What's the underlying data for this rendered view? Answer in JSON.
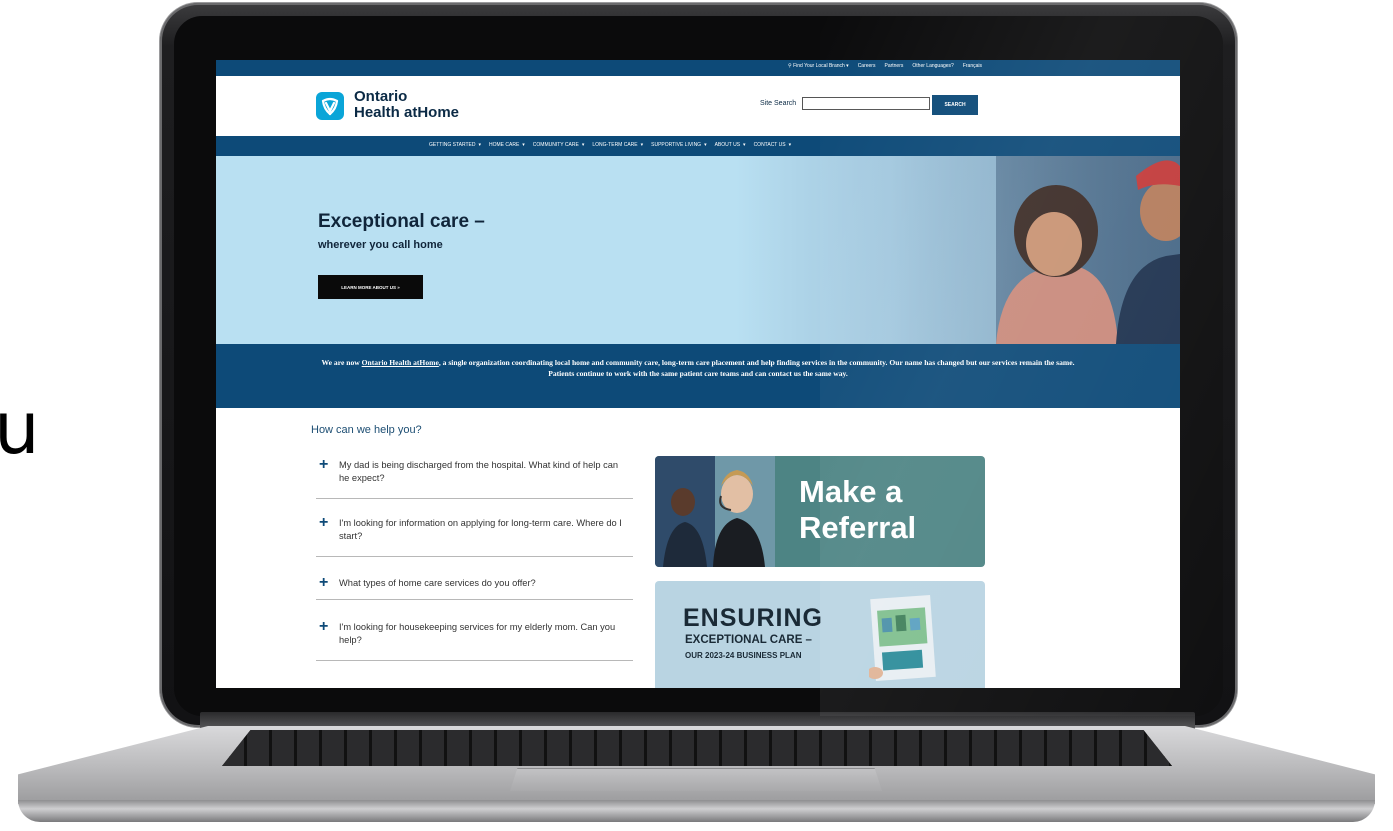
{
  "edge_glyph": "u",
  "screen": {
    "utility_bar": {
      "links": [
        "Find Your Local Branch",
        "Careers",
        "Partners",
        "Other Languages?",
        "Français"
      ]
    },
    "logo": {
      "line1": "Ontario",
      "line2": "Health atHome"
    },
    "search": {
      "label": "Site Search",
      "input_value": "",
      "button": "SEARCH"
    },
    "main_nav": {
      "items": [
        "GETTING STARTED",
        "HOME CARE",
        "COMMUNITY CARE",
        "LONG-TERM CARE",
        "SUPPORTIVE LIVING",
        "ABOUT US",
        "CONTACT US"
      ]
    },
    "hero": {
      "title": "Exceptional care –",
      "subtitle": "wherever you call home",
      "button": "LEARN MORE ABOUT US »"
    },
    "notice": {
      "before": "We are now ",
      "link": "Ontario Health atHome",
      "after": ", a single organization coordinating local home and community care, long-term care placement and help finding services in the community. Our name has changed but our services remain the same. Patients continue to work with the same patient care teams and can contact us the same way."
    },
    "help": {
      "title": "How can we help you?",
      "questions": [
        "My dad is being discharged from the hospital. What kind of help can he expect?",
        "I'm looking for information on applying for long-term care. Where do I start?",
        "What types of home care services do you offer?",
        "I'm looking for housekeeping services for my elderly mom. Can you help?"
      ]
    },
    "referral_card": {
      "line1": "Make a",
      "line2": "Referral"
    },
    "plan_card": {
      "line1": "ENSURING",
      "line2": "EXCEPTIONAL CARE –",
      "line3": "OUR 2023-24 BUSINESS PLAN"
    }
  }
}
